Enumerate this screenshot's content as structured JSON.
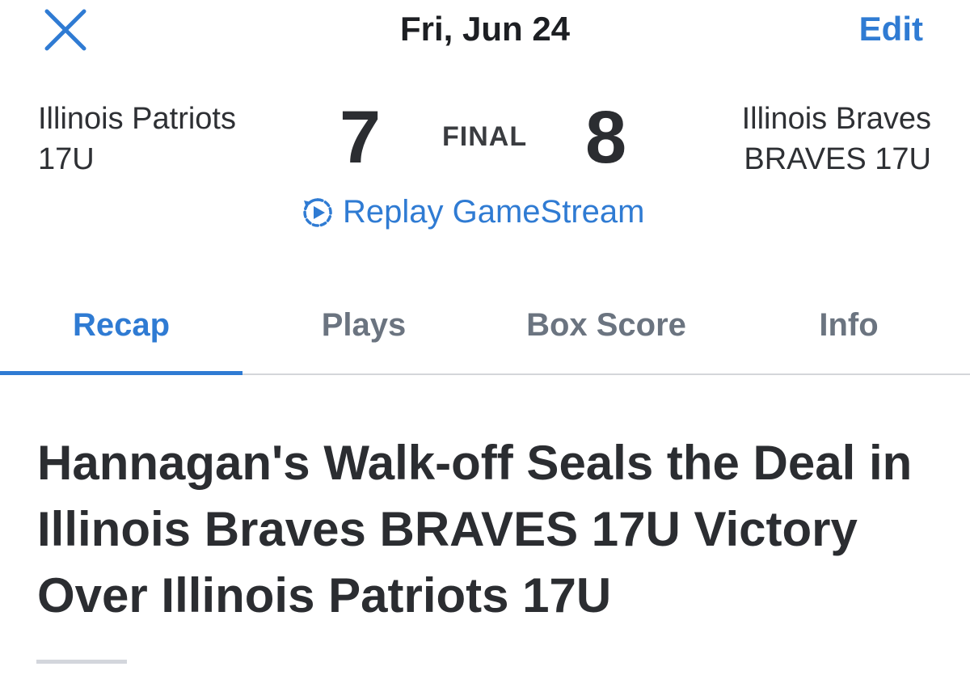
{
  "header": {
    "close_icon": "close-icon",
    "date": "Fri, Jun 24",
    "edit_label": "Edit",
    "accent_color": "#2f7bd3"
  },
  "scoreboard": {
    "away_team": {
      "name_line1": "Illinois Patriots",
      "name_line2": "17U",
      "score": "7"
    },
    "home_team": {
      "name_line1": "Illinois Braves",
      "name_line2": "BRAVES 17U",
      "score": "8"
    },
    "status": "FINAL",
    "replay_icon": "replay-icon",
    "replay_label": "Replay GameStream"
  },
  "tabs": [
    {
      "label": "Recap",
      "active": true
    },
    {
      "label": "Plays",
      "active": false
    },
    {
      "label": "Box Score",
      "active": false
    },
    {
      "label": "Info",
      "active": false
    }
  ],
  "recap": {
    "headline": "Hannagan's Walk-off Seals the Deal in Illinois Braves BRAVES 17U Victory Over Illinois Patriots 17U"
  }
}
